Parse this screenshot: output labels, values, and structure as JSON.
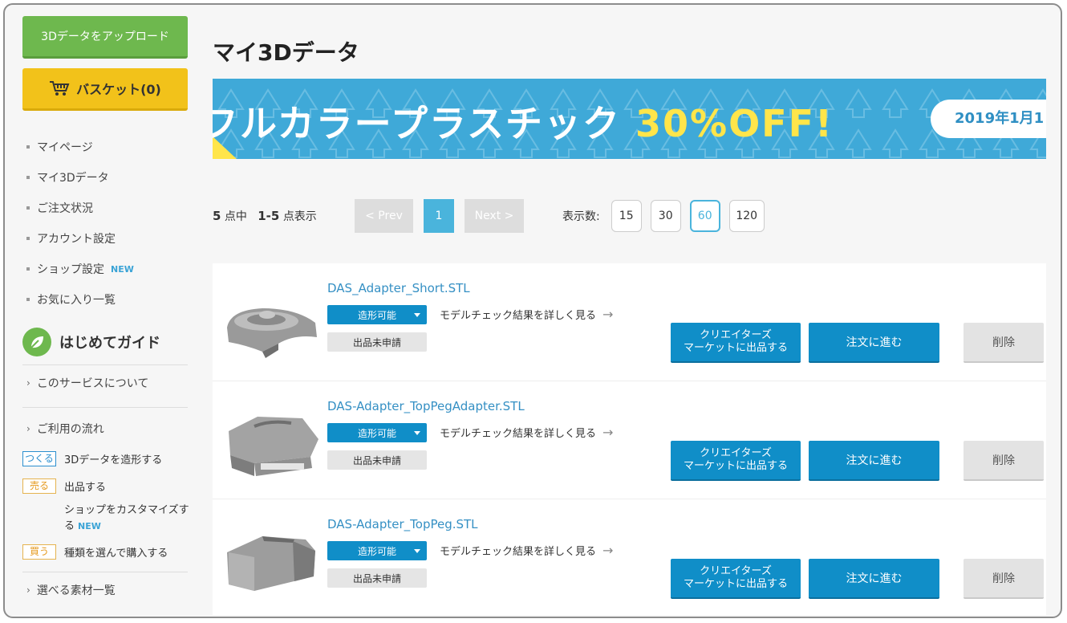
{
  "sidebar": {
    "upload_label": "3Dデータをアップロード",
    "basket_label": "バスケット(0)",
    "nav": [
      {
        "label": "マイページ",
        "new": ""
      },
      {
        "label": "マイ3Dデータ",
        "new": ""
      },
      {
        "label": "ご注文状況",
        "new": ""
      },
      {
        "label": "アカウント設定",
        "new": ""
      },
      {
        "label": "ショップ設定",
        "new": "NEW"
      },
      {
        "label": "お気に入り一覧",
        "new": ""
      }
    ],
    "guide": {
      "title": "はじめてガイド",
      "about": "このサービスについて",
      "flow_title": "ご利用の流れ",
      "flow": [
        {
          "tag": "つくる",
          "label": "3Dデータを造形する"
        },
        {
          "tag": "売る",
          "label": "出品する"
        }
      ],
      "customize": "ショップをカスタマイズする",
      "customize_new": "NEW",
      "buy": {
        "tag": "買う",
        "label": "種類を選んで購入する"
      },
      "materials": "選べる素材一覧"
    }
  },
  "main": {
    "title": "マイ3Dデータ",
    "banner": {
      "headline": "フルカラープラスチック",
      "discount": "30%OFF!",
      "date": "2019年1月1"
    },
    "pagination": {
      "total": "5",
      "total_suffix": "点中",
      "range": "1-5",
      "range_suffix": "点表示",
      "prev": "< Prev",
      "current": "1",
      "next": "Next >",
      "per_page_label": "表示数:",
      "per_page_options": [
        "15",
        "30",
        "60",
        "120"
      ],
      "per_page_selected": "60"
    },
    "items": [
      {
        "filename": "DAS_Adapter_Short.STL",
        "status": "造形可能",
        "check_link": "モデルチェック結果を詳しく見る",
        "listing": "出品未申請",
        "market_btn_1": "クリエイターズ",
        "market_btn_2": "マーケットに出品する",
        "order_btn": "注文に進む",
        "delete_btn": "削除"
      },
      {
        "filename": "DAS-Adapter_TopPegAdapter.STL",
        "status": "造形可能",
        "check_link": "モデルチェック結果を詳しく見る",
        "listing": "出品未申請",
        "market_btn_1": "クリエイターズ",
        "market_btn_2": "マーケットに出品する",
        "order_btn": "注文に進む",
        "delete_btn": "削除"
      },
      {
        "filename": "DAS-Adapter_TopPeg.STL",
        "status": "造形可能",
        "check_link": "モデルチェック結果を詳しく見る",
        "listing": "出品未申請",
        "market_btn_1": "クリエイターズ",
        "market_btn_2": "マーケットに出品する",
        "order_btn": "注文に進む",
        "delete_btn": "削除"
      }
    ]
  }
}
